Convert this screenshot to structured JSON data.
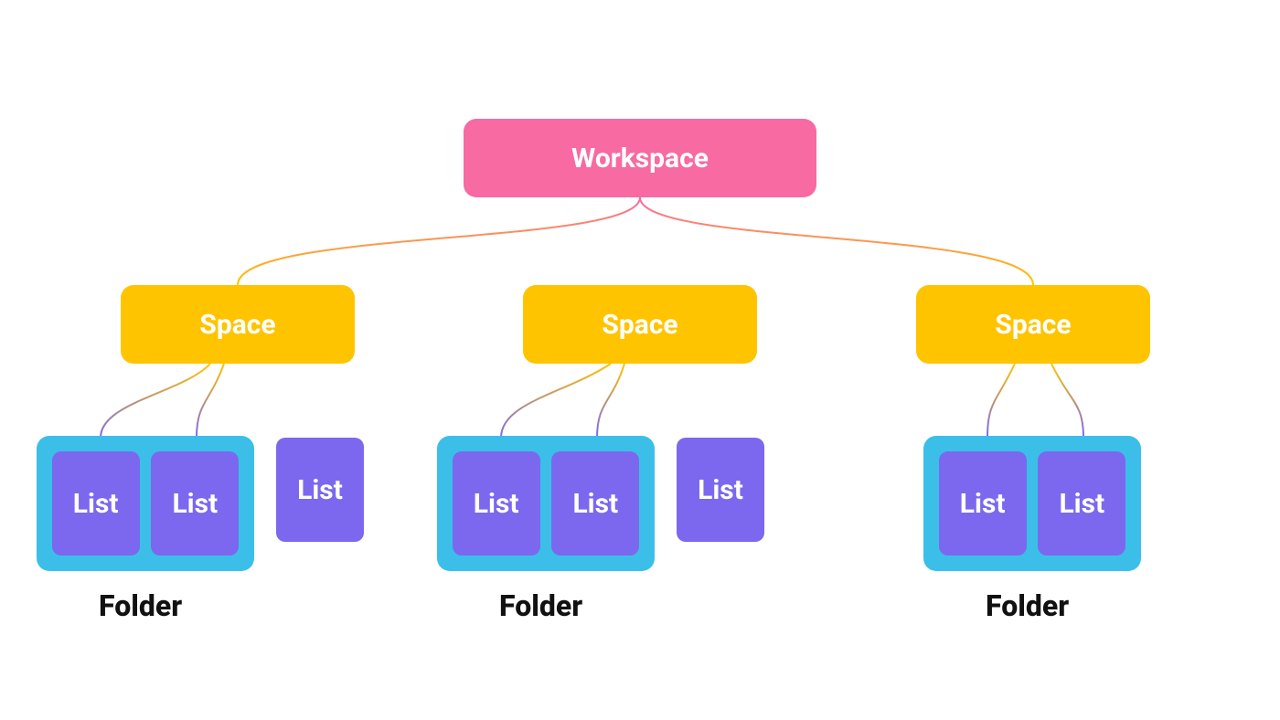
{
  "diagram": {
    "root": {
      "label": "Workspace"
    },
    "spaces": [
      {
        "label": "Space"
      },
      {
        "label": "Space"
      },
      {
        "label": "Space"
      }
    ],
    "lists": {
      "label": "List"
    },
    "folder_label": "Folder"
  },
  "colors": {
    "workspace": "#f76aa2",
    "space": "#ffc400",
    "folder": "#3bbfe9",
    "list": "#7b68ee",
    "text_dark": "#111111",
    "text_light": "#ffffff"
  },
  "structure": {
    "description": "Hierarchy: Workspace -> 3 Spaces. Space 1 -> Folder (2 Lists) + 1 standalone List. Space 2 -> Folder (2 Lists) + 1 standalone List. Space 3 -> Folder (2 Lists)."
  }
}
